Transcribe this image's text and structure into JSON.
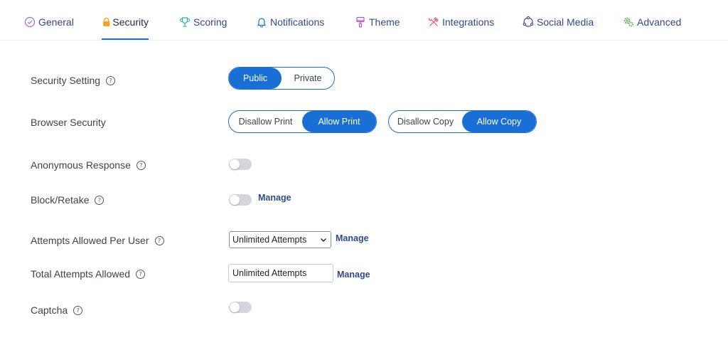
{
  "tabs": [
    {
      "label": "General"
    },
    {
      "label": "Security"
    },
    {
      "label": "Scoring"
    },
    {
      "label": "Notifications"
    },
    {
      "label": "Theme"
    },
    {
      "label": "Integrations"
    },
    {
      "label": "Social Media"
    },
    {
      "label": "Advanced"
    }
  ],
  "active_tab": "Security",
  "colors": {
    "accent": "#1a6fd6",
    "general_icon": "#9b6fd6",
    "security_icon": "#f3a21c",
    "scoring_icon": "#2bb3a0",
    "notifications_icon": "#1a6fd6",
    "theme_icon": "#b45ab8",
    "integrations_icon": "#e0506a",
    "social_icon": "#3a4a8a",
    "advanced_icon": "#4aa84a"
  },
  "settings": {
    "security_setting": {
      "label": "Security Setting",
      "options": [
        "Public",
        "Private"
      ],
      "selected": "Public"
    },
    "browser_security": {
      "label": "Browser Security",
      "print_options": [
        "Disallow Print",
        "Allow Print"
      ],
      "print_selected": "Allow Print",
      "copy_options": [
        "Disallow Copy",
        "Allow Copy"
      ],
      "copy_selected": "Allow Copy"
    },
    "anonymous_response": {
      "label": "Anonymous Response",
      "enabled": false
    },
    "block_retake": {
      "label": "Block/Retake",
      "enabled": false,
      "manage_label": "Manage"
    },
    "attempts_per_user": {
      "label": "Attempts Allowed Per User",
      "value": "Unlimited Attempts",
      "manage_label": "Manage"
    },
    "total_attempts": {
      "label": "Total Attempts Allowed",
      "value": "Unlimited Attempts",
      "manage_label": "Manage"
    },
    "captcha": {
      "label": "Captcha",
      "enabled": false
    }
  },
  "help_glyph": "?"
}
